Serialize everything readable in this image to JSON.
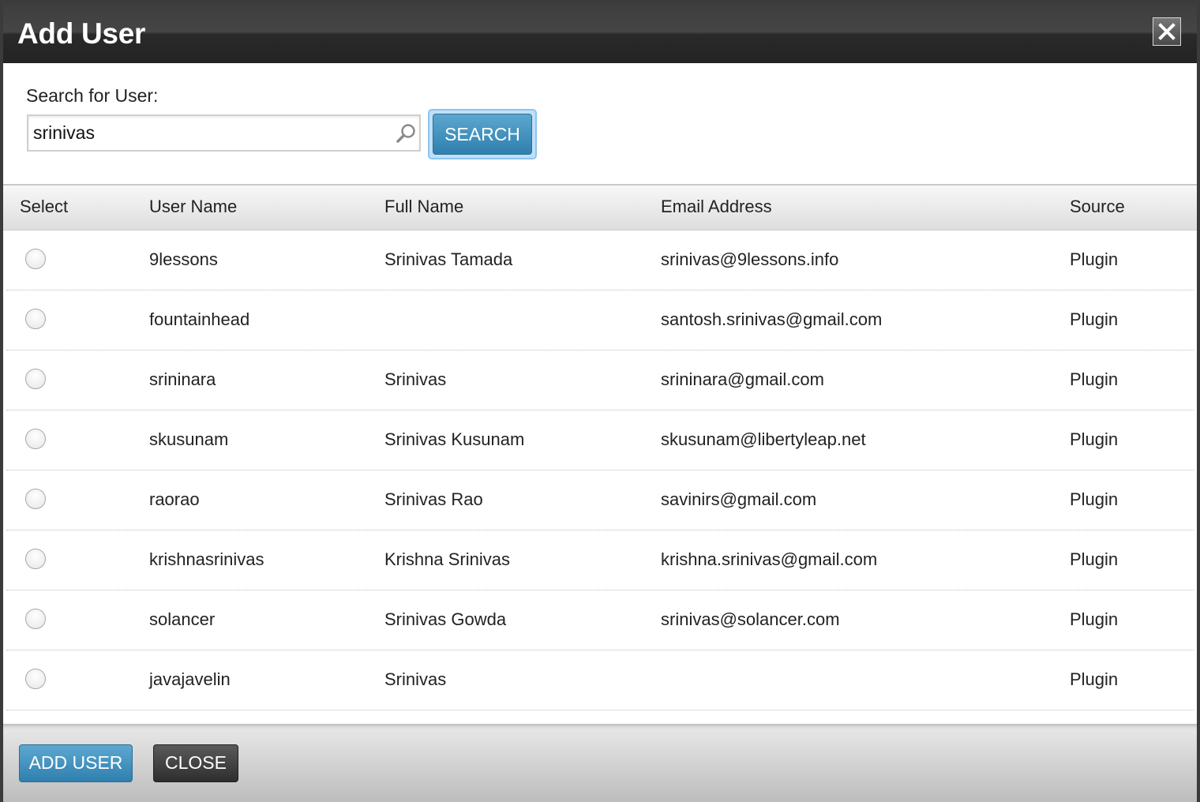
{
  "dialog": {
    "title": "Add User"
  },
  "search": {
    "label": "Search for User:",
    "value": "srinivas",
    "button_label": "SEARCH"
  },
  "table": {
    "headers": [
      "Select",
      "User Name",
      "Full Name",
      "Email Address",
      "Source"
    ],
    "rows": [
      {
        "username": "9lessons",
        "fullname": "Srinivas Tamada",
        "email": "srinivas@9lessons.info",
        "source": "Plugin"
      },
      {
        "username": "fountainhead",
        "fullname": "",
        "email": "santosh.srinivas@gmail.com",
        "source": "Plugin"
      },
      {
        "username": "srininara",
        "fullname": "Srinivas",
        "email": "srininara@gmail.com",
        "source": "Plugin"
      },
      {
        "username": "skusunam",
        "fullname": "Srinivas Kusunam",
        "email": "skusunam@libertyleap.net",
        "source": "Plugin"
      },
      {
        "username": "raorao",
        "fullname": "Srinivas Rao",
        "email": "savinirs@gmail.com",
        "source": "Plugin"
      },
      {
        "username": "krishnasrinivas",
        "fullname": "Krishna Srinivas",
        "email": "krishna.srinivas@gmail.com",
        "source": "Plugin"
      },
      {
        "username": "solancer",
        "fullname": "Srinivas Gowda",
        "email": "srinivas@solancer.com",
        "source": "Plugin"
      },
      {
        "username": "javajavelin",
        "fullname": "Srinivas",
        "email": "",
        "source": "Plugin"
      }
    ]
  },
  "footer": {
    "add_label": "ADD USER",
    "close_label": "CLOSE"
  },
  "icons": {
    "close": "close-icon",
    "search": "search-icon"
  }
}
